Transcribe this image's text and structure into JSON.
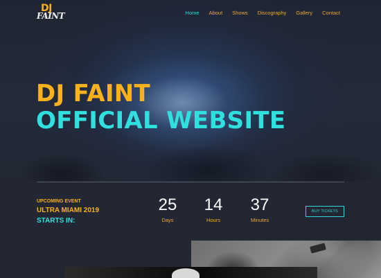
{
  "brand": {
    "logo_top": "DJ",
    "logo_bottom": "FAINT"
  },
  "nav": {
    "items": [
      {
        "label": "Home",
        "active": true
      },
      {
        "label": "About",
        "active": false
      },
      {
        "label": "Shows",
        "active": false
      },
      {
        "label": "Discography",
        "active": false
      },
      {
        "label": "Gallery",
        "active": false
      },
      {
        "label": "Contact",
        "active": false
      }
    ]
  },
  "hero": {
    "title_line1": "DJ FAINT",
    "title_line2": "OFFICIAL WEBSITE"
  },
  "event": {
    "label": "UPCOMING EVENT",
    "name": "ULTRA MIAMI 2019",
    "starts": "STARTS IN:",
    "countdown": [
      {
        "value": "25",
        "unit": "Days"
      },
      {
        "value": "14",
        "unit": "Hours"
      },
      {
        "value": "37",
        "unit": "Minutes"
      }
    ],
    "buy_label": "BUY TICKETS"
  },
  "colors": {
    "accent_yellow": "#f9b21b",
    "accent_cyan": "#2fe0de",
    "background": "#222733"
  }
}
